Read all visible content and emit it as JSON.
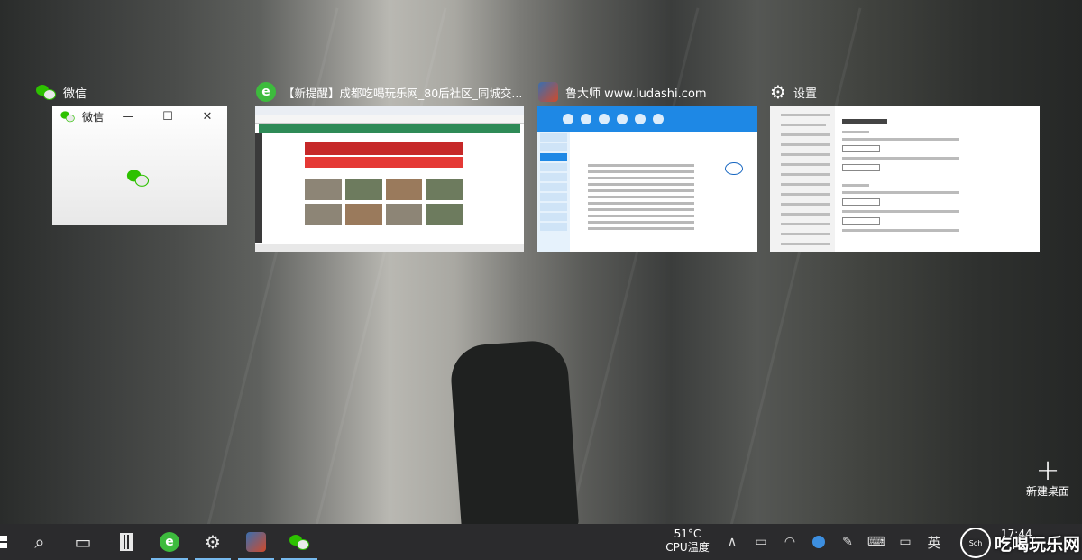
{
  "task_view": {
    "windows": [
      {
        "title": "微信",
        "icon": "wechat-icon",
        "thumb_title": "微信",
        "thumb_controls": [
          "—",
          "☐",
          "✕"
        ]
      },
      {
        "title": "【新提醒】成都吃喝玩乐网_80后社区_同城交...",
        "icon": "browser-icon"
      },
      {
        "title": "鲁大师 www.ludashi.com",
        "icon": "ludashi-icon"
      },
      {
        "title": "设置",
        "icon": "gear-icon"
      }
    ],
    "new_desktop": {
      "icon": "+",
      "label": "新建桌面"
    }
  },
  "taskbar": {
    "start_icon": "windows-icon",
    "search_icon": "⌕",
    "taskview_icon": "▭",
    "apps": [
      {
        "name": "calculator",
        "icon": "calculator-icon"
      },
      {
        "name": "browser",
        "icon": "browser-icon",
        "glyph": "e"
      },
      {
        "name": "settings",
        "icon": "gear-icon",
        "glyph": "⚙"
      },
      {
        "name": "ludashi",
        "icon": "ludashi-icon"
      },
      {
        "name": "wechat",
        "icon": "wechat-icon"
      }
    ],
    "temperature": {
      "value": "51°C",
      "label": "CPU温度"
    },
    "tray": {
      "chevron": "∧",
      "input_method": "英",
      "time": "17:44"
    }
  },
  "watermark": {
    "text": "吃喝玩乐网",
    "logo_text": "Sch"
  },
  "colors": {
    "taskbar_bg": "#2b2b2d",
    "active_indicator": "#76b9ed",
    "wechat_green": "#2dc100",
    "ludashi_blue": "#1e88e5"
  }
}
